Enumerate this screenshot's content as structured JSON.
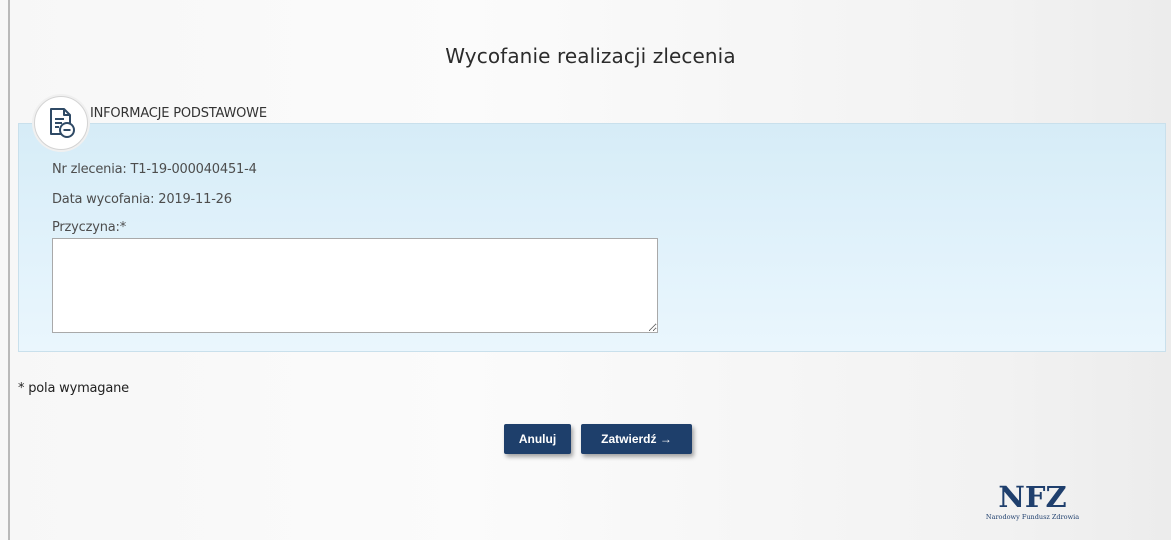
{
  "page": {
    "title": "Wycofanie realizacji zlecenia"
  },
  "section": {
    "header": "INFORMACJE PODSTAWOWE",
    "icon": "document-minus-icon"
  },
  "fields": {
    "order_number_label": "Nr zlecenia: T1-19-000040451-4",
    "withdrawal_date_label": "Data wycofania: 2019-11-26",
    "reason_label": "Przyczyna:*",
    "reason_value": ""
  },
  "footer": {
    "required_note": "* pola wymagane"
  },
  "buttons": {
    "cancel_label": "Anuluj",
    "confirm_label": "Zatwierdź →"
  },
  "logo": {
    "main": "NFZ",
    "sub": "Narodowy Fundusz Zdrowia"
  },
  "colors": {
    "panel_bg": "#dff0fa",
    "button_bg": "#1e3f6b",
    "logo": "#1f3f6d"
  }
}
